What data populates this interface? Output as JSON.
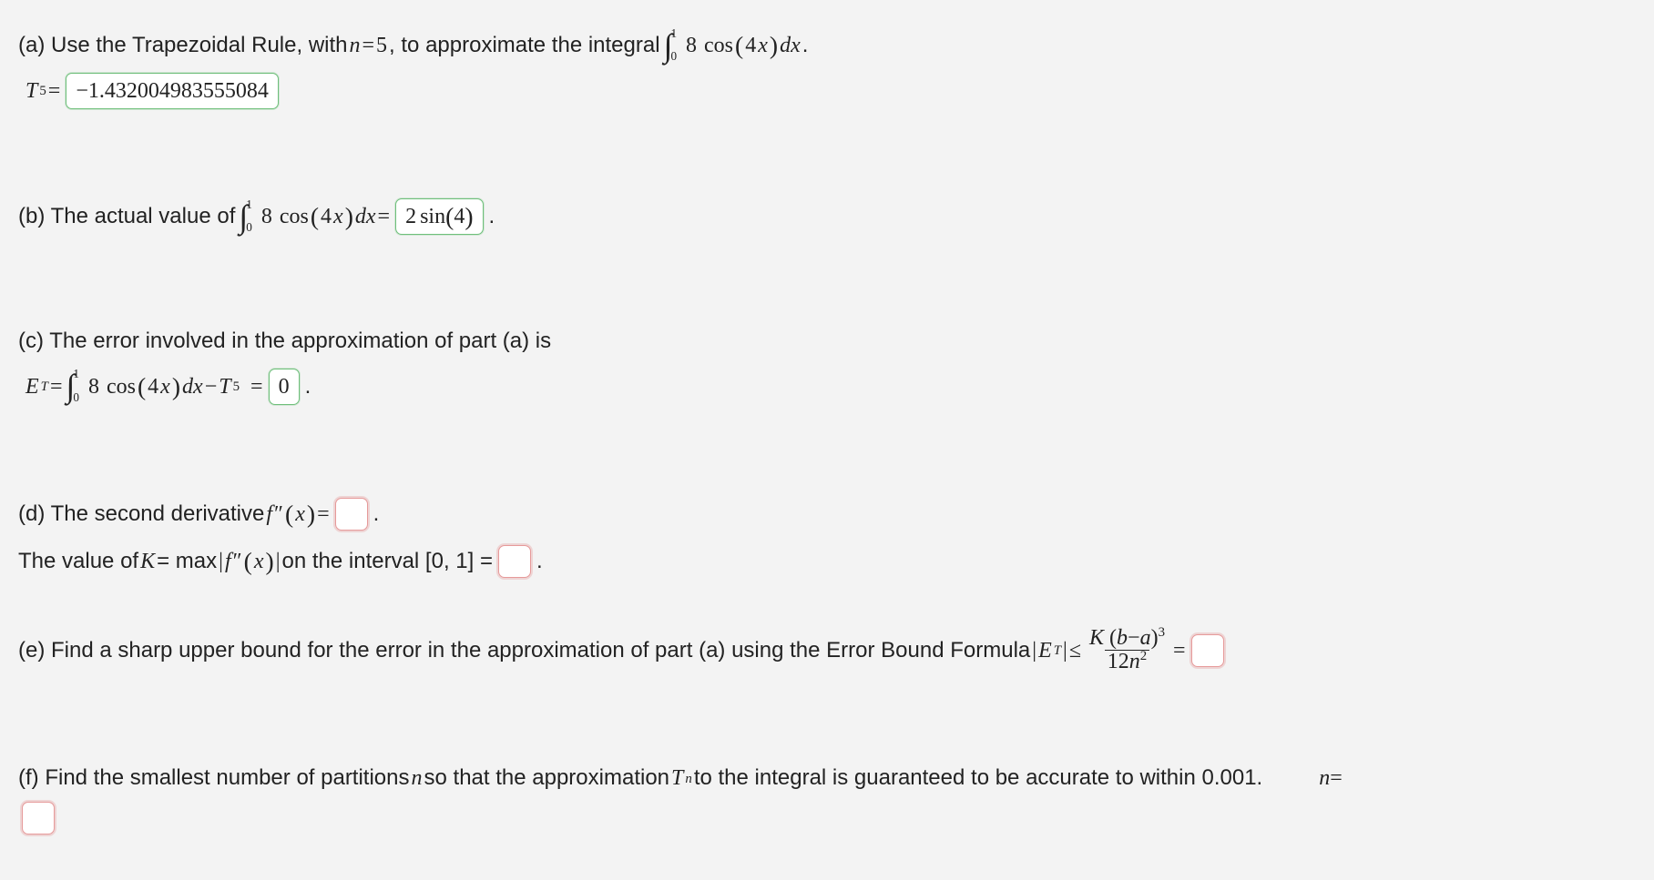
{
  "a": {
    "prompt_prefix": "(a) Use the Trapezoidal Rule, with ",
    "n_var": "n",
    "eq": " = ",
    "n_val": "5",
    "prompt_mid": ", to approximate the integral ",
    "int_upper": "1",
    "int_lower": "0",
    "integrand_coef": "8",
    "integrand_fn": "cos",
    "integrand_arg_coef": "4",
    "integrand_arg_var": "x",
    "dx": "dx",
    "period": ".",
    "T_label": "T",
    "T_sub": "5",
    "T_eq": " = ",
    "answer": "−1.432004983555084"
  },
  "b": {
    "prompt_prefix": "(b) The actual value of ",
    "int_upper": "1",
    "int_lower": "0",
    "integrand_coef": "8",
    "integrand_fn": "cos",
    "integrand_arg_coef": "4",
    "integrand_arg_var": "x",
    "dx": "dx",
    "eq": " = ",
    "answer_coef": "2",
    "answer_fn": "sin",
    "answer_arg": "4",
    "period": "."
  },
  "c": {
    "line1": "(c) The error involved in the approximation of part (a) is",
    "E_label": "E",
    "E_sub": "T",
    "eq1": " = ",
    "int_upper": "1",
    "int_lower": "0",
    "integrand_coef": "8",
    "integrand_fn": "cos",
    "integrand_arg_coef": "4",
    "integrand_arg_var": "x",
    "dx": "dx",
    "minus": " − ",
    "T_label": "T",
    "T_sub": "5",
    "eq2": " = ",
    "answer": "0",
    "period": "."
  },
  "d": {
    "line1_prefix": "(d) The second derivative ",
    "f_label": "f",
    "prime": "″",
    "arg_var": "x",
    "eq1": " = ",
    "period1": ".",
    "line2_prefix": "The value of ",
    "K_label": "K",
    "line2_mid1": " = max ",
    "line2_mid2": " on the interval [0, 1] = ",
    "period2": "."
  },
  "e": {
    "prefix": "(e) Find a sharp upper bound for the error in the approximation of part (a) using the Error Bound Formula ",
    "E_label": "E",
    "E_sub": "T",
    "le": " ≤ ",
    "num_K": "K",
    "num_b": "b",
    "num_minus": "−",
    "num_a": "a",
    "num_exp": "3",
    "den_coef": "12",
    "den_n": "n",
    "den_exp": "2",
    "eq": " = "
  },
  "f": {
    "prefix": "(f) Find the smallest number of partitions ",
    "n_var": "n",
    "mid": " so that the approximation ",
    "T_label": "T",
    "T_sub": "n",
    "suffix": " to the integral is guaranteed to be accurate to within 0.001.",
    "n_eq_label": "n",
    "n_eq": " ="
  }
}
